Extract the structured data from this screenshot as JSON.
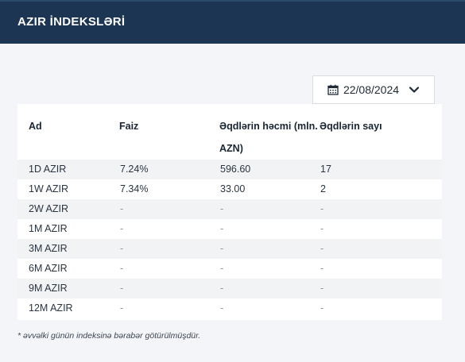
{
  "header": {
    "title": "AZIR İNDEKSLƏRİ"
  },
  "date_picker": {
    "value": "22/08/2024",
    "icon": "calendar-icon",
    "dropdown_icon": "chevron-down-icon"
  },
  "table": {
    "columns": [
      "Ad",
      "Faiz",
      "Əqdlərin həcmi (mln. AZN)",
      "Əqdlərin sayı"
    ],
    "rows": [
      [
        "1D AZIR",
        "7.24%",
        "596.60",
        "17"
      ],
      [
        "1W AZIR",
        "7.34%",
        "33.00",
        "2"
      ],
      [
        "2W AZIR",
        "-",
        "-",
        "-"
      ],
      [
        "1M AZIR",
        "-",
        "-",
        "-"
      ],
      [
        "3M AZIR",
        "-",
        "-",
        "-"
      ],
      [
        "6M AZIR",
        "-",
        "-",
        "-"
      ],
      [
        "9M AZIR",
        "-",
        "-",
        "-"
      ],
      [
        "12M AZIR",
        "-",
        "-",
        "-"
      ]
    ]
  },
  "footnote": "* əvvəlki günün indeksinə bərabər götürülmüşdür.",
  "colors": {
    "header_bg": "#1c3552",
    "stripe": "#f2f3f5",
    "panel_bg": "#f4f5f8"
  }
}
